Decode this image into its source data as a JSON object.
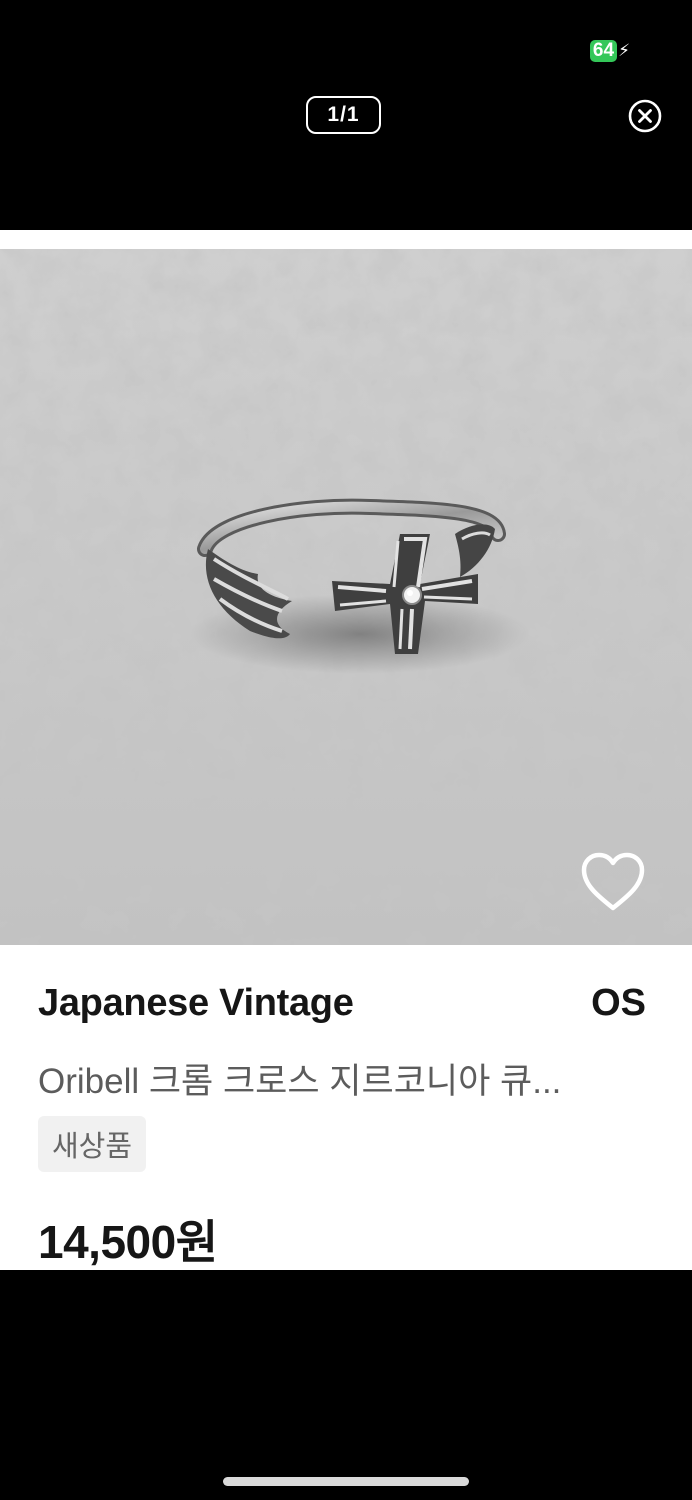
{
  "status_bar": {
    "battery_level": "64",
    "battery_color": "#34c759"
  },
  "viewer": {
    "page_counter": "1/1",
    "close_icon": "close-circle-icon"
  },
  "product": {
    "image_subject": "silver cross ring photo",
    "brand": "Japanese Vintage",
    "size": "OS",
    "title": "Oribell 크롬 크로스 지르코니아 큐...",
    "condition": "새상품",
    "price": "14,500원",
    "like_icon": "heart-outline-icon"
  }
}
